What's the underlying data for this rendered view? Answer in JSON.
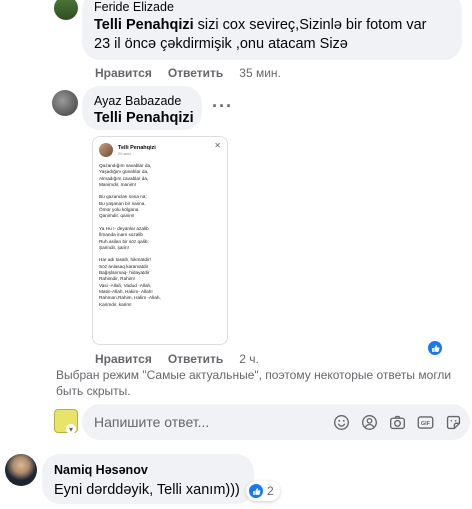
{
  "comment_feride": {
    "author": "Feride Elizade",
    "mention": "Telli Penahqizi",
    "text_line1": " sizi cox sevireç,Sizinlə bir fotom var",
    "text_line2": "23 il öncə çəkdirmişik ,onu atacam Sizə",
    "like_label": "Нравится",
    "reply_label": "Ответить",
    "time": "35 мин."
  },
  "comment_ayaz": {
    "author": "Ayaz Babazade",
    "mention": "Telli Penahqizi",
    "like_label": "Нравится",
    "reply_label": "Ответить",
    "time": "2 ч.",
    "attachment": {
      "name": "Telli Penahqizi",
      "meta": "20 мин. ·",
      "poem": "Qazandığım savablar da,\nYaşadığım günahlar da,\nAlmadığım cavablar da,\nManimdir, manim!\n\nBu qazanclan səna na;\nBu yaşanan bir nasna,\nÖmür yolu kölgana\nQanimdir, qanim!\n\nYa Hu !- deyanlar azalib\nİlmanda inam sozalib\nRuh asilan bir söz qalib:\nŞarindir, şarin!\n\nHar adı tasallı, hikmatdir!\nSöz anlasaq karamatdir\nBağışlanmaq- hidayatdir\nRahimdir, Rahim!\nVasi -Allah, Vadud -Allah,\nMatin-Allah, Hakim- Allah!\nRahman,Rahim, Halim -Allah,\nKarimdir, karim!"
    }
  },
  "notice": "Выбран режим \"Самые актуальные\", поэтому некоторые ответы могли быть скрыты.",
  "composer": {
    "placeholder": "Напишите ответ..."
  },
  "comment_namiq": {
    "author": "Namiq Həsənov",
    "text": "Eyni dərddəyik, Telli xanım)))",
    "reactions_count": "2"
  },
  "colors": {
    "accent": "#1877f2",
    "bubble": "#f0f2f5",
    "secondary_text": "#65676b"
  }
}
